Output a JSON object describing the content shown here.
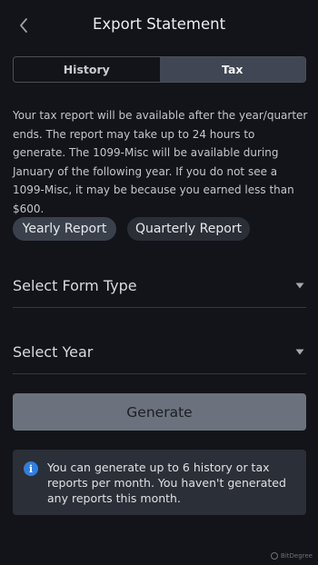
{
  "header": {
    "title": "Export Statement",
    "back_icon": "chevron-left-icon"
  },
  "tabs": [
    {
      "label": "History",
      "active": false
    },
    {
      "label": "Tax",
      "active": true
    }
  ],
  "info": {
    "text": "Your tax report will be available after the year/quarter ends. The report may take up to 24 hours to generate. The 1099-Misc will be available during January of the following year. If you do not see a 1099-Misc, it may be because you earned less than $600."
  },
  "report_types": [
    {
      "label": "Yearly Report",
      "selected": true
    },
    {
      "label": "Quarterly Report",
      "selected": false
    }
  ],
  "form_type": {
    "label": "Select Form Type",
    "icon": "caret-down-icon"
  },
  "year": {
    "label": "Select Year",
    "icon": "caret-down-icon"
  },
  "generate": {
    "label": "Generate"
  },
  "notice": {
    "icon": "info-icon",
    "text": "You can generate up to 6 history or tax reports per month. You haven't generated any reports this month."
  },
  "watermark": {
    "text": "BitDegree"
  },
  "colors": {
    "background": "#121419",
    "tab_active": "#404653",
    "chip_active": "#3b414c",
    "chip_inactive": "#2a2e36",
    "button_disabled": "#6b717d",
    "notice_bg": "#2b2f37",
    "info_blue": "#2f7fe0"
  }
}
